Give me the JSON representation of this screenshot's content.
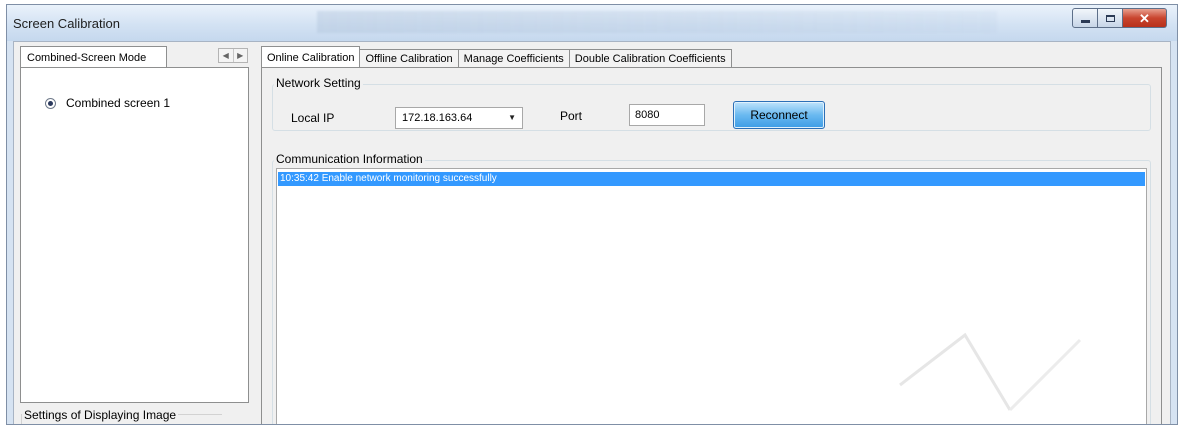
{
  "window": {
    "title": "Screen Calibration",
    "buttons": {
      "minimize": "minimize-icon",
      "maximize": "maximize-icon",
      "close": "close-icon"
    }
  },
  "left_panel": {
    "tab_label": "Combined-Screen Mode",
    "screens": [
      {
        "label": "Combined screen 1",
        "selected": true
      }
    ],
    "settings_group_label": "Settings of Displaying Image"
  },
  "tabs": [
    {
      "label": "Online Calibration",
      "active": true
    },
    {
      "label": "Offline Calibration",
      "active": false
    },
    {
      "label": "Manage Coefficients",
      "active": false
    },
    {
      "label": "Double Calibration Coefficients",
      "active": false
    }
  ],
  "network_setting": {
    "group_label": "Network Setting",
    "local_ip_label": "Local IP",
    "local_ip_value": "172.18.163.64",
    "port_label": "Port",
    "port_value": "8080",
    "reconnect_label": "Reconnect"
  },
  "communication": {
    "group_label": "Communication Information",
    "log": [
      "10:35:42  Enable network monitoring successfully"
    ]
  },
  "colors": {
    "selection": "#3399ff",
    "reconnect_accent": "#3d9ce6",
    "close_button": "#c9452e"
  }
}
